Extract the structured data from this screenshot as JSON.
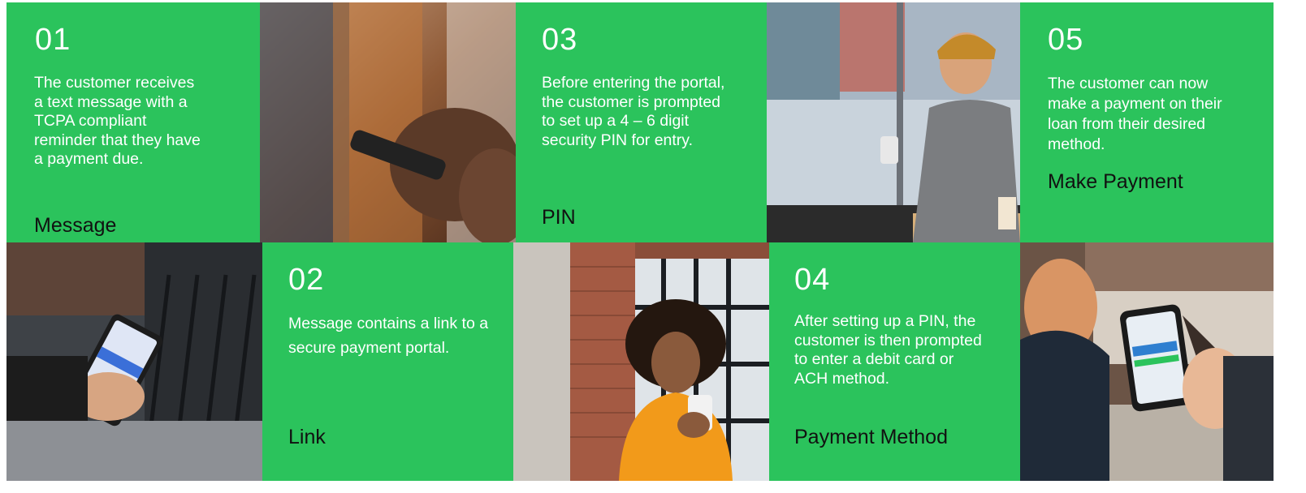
{
  "steps": [
    {
      "number": "01",
      "description": "The customer receives a text message with a TCPA compliant reminder that they have a payment due.",
      "label": "Message"
    },
    {
      "number": "02",
      "description": "Message contains a link to a secure payment portal.",
      "label": "Link"
    },
    {
      "number": "03",
      "description": "Before entering the portal, the customer is prompted to set up a 4 – 6 digit security PIN for entry.",
      "label": "PIN"
    },
    {
      "number": "04",
      "description": "After setting up a PIN, the customer is then prompted to enter a debit card or ACH method.",
      "label": "Payment Method"
    },
    {
      "number": "05",
      "description": "The customer can now make a payment on their loan from their desired method.",
      "label": "Make Payment"
    }
  ],
  "colors": {
    "accent_green": "#2bc35c",
    "label_text": "#111111",
    "body_text": "#ffffff"
  }
}
